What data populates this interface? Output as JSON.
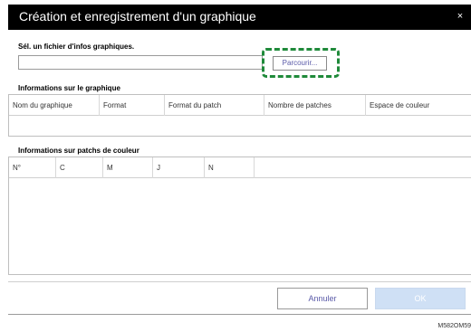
{
  "dialog": {
    "title": "Création et enregistrement d'un graphique",
    "close_glyph": "×"
  },
  "file_select": {
    "label": "Sél. un fichier d'infos graphiques.",
    "value": "",
    "placeholder": "",
    "browse_label": "Parcourir..."
  },
  "chart_info": {
    "label": "Informations sur le graphique",
    "columns": [
      "Nom du graphique",
      "Format",
      "Format du patch",
      "Nombre de patches",
      "Espace de couleur"
    ],
    "rows": []
  },
  "patch_info": {
    "label": "Informations sur patchs de couleur",
    "columns": [
      "N°",
      "C",
      "M",
      "J",
      "N"
    ],
    "rows": []
  },
  "footer": {
    "cancel_label": "Annuler",
    "ok_label": "OK"
  },
  "figure_code": "M582OM59",
  "colors": {
    "title_bar": "#000000",
    "highlight": "#1f8a3a",
    "ok_disabled": "#cfe0f5",
    "link_text": "#5a5aa8"
  },
  "icons": {
    "close": "close-icon"
  }
}
